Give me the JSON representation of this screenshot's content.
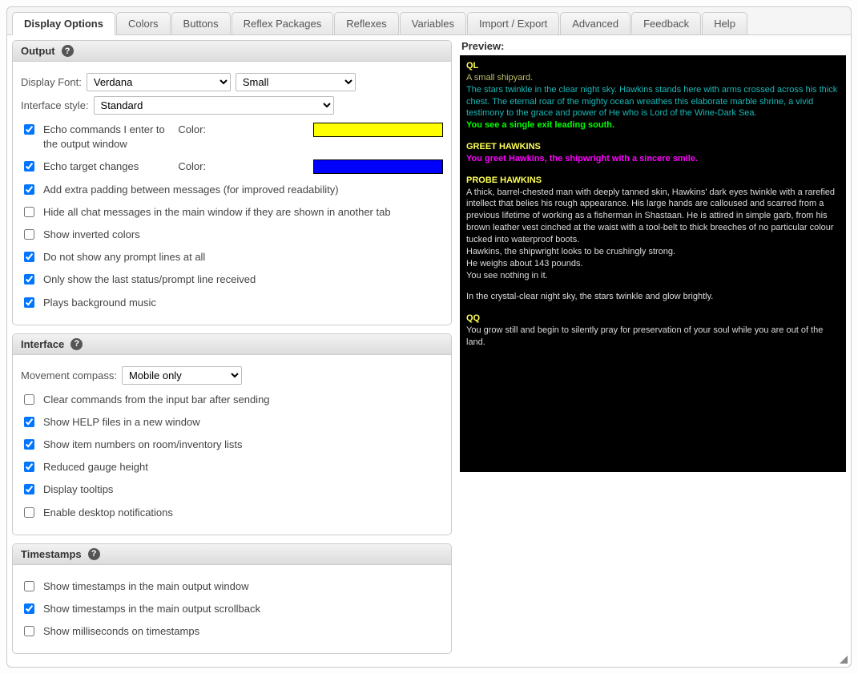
{
  "tabs": [
    {
      "label": "Display Options",
      "active": true
    },
    {
      "label": "Colors"
    },
    {
      "label": "Buttons"
    },
    {
      "label": "Reflex Packages"
    },
    {
      "label": "Reflexes"
    },
    {
      "label": "Variables"
    },
    {
      "label": "Import / Export"
    },
    {
      "label": "Advanced"
    },
    {
      "label": "Feedback"
    },
    {
      "label": "Help"
    }
  ],
  "output": {
    "title": "Output",
    "display_font_label": "Display Font:",
    "display_font_value": "Verdana",
    "display_size_value": "Small",
    "interface_style_label": "Interface style:",
    "interface_style_value": "Standard",
    "echo_commands": {
      "checked": true,
      "label": "Echo commands I enter to the output window",
      "color_label": "Color:",
      "color": "#ffff00"
    },
    "echo_target": {
      "checked": true,
      "label": "Echo target changes",
      "color_label": "Color:",
      "color": "#0000ff"
    },
    "extra_padding": {
      "checked": true,
      "label": "Add extra padding between messages (for improved readability)"
    },
    "hide_chat": {
      "checked": false,
      "label": "Hide all chat messages in the main window if they are shown in another tab"
    },
    "inverted": {
      "checked": false,
      "label": "Show inverted colors"
    },
    "no_prompt": {
      "checked": true,
      "label": "Do not show any prompt lines at all"
    },
    "last_status": {
      "checked": true,
      "label": "Only show the last status/prompt line received"
    },
    "music": {
      "checked": true,
      "label": "Plays background music"
    }
  },
  "interface": {
    "title": "Interface",
    "compass_label": "Movement compass:",
    "compass_value": "Mobile only",
    "clear_commands": {
      "checked": false,
      "label": "Clear commands from the input bar after sending"
    },
    "help_window": {
      "checked": true,
      "label": "Show HELP files in a new window"
    },
    "item_numbers": {
      "checked": true,
      "label": "Show item numbers on room/inventory lists"
    },
    "reduced_gauge": {
      "checked": true,
      "label": "Reduced gauge height"
    },
    "tooltips": {
      "checked": true,
      "label": "Display tooltips"
    },
    "desktop_notif": {
      "checked": false,
      "label": "Enable desktop notifications"
    }
  },
  "timestamps": {
    "title": "Timestamps",
    "main_output": {
      "checked": false,
      "label": "Show timestamps in the main output window"
    },
    "scrollback": {
      "checked": true,
      "label": "Show timestamps in the main output scrollback"
    },
    "millis": {
      "checked": false,
      "label": "Show milliseconds on timestamps"
    }
  },
  "preview": {
    "label": "Preview:",
    "ql_cmd": "QL",
    "ql_title": "A small shipyard.",
    "ql_desc": "The stars twinkle in the clear night sky. Hawkins stands here with arms crossed across his thick chest. The eternal roar of the mighty ocean wreathes this elaborate marble shrine, a vivid testimony to the grace and power of He who is Lord of the Wine-Dark Sea.",
    "ql_exit": "You see a single exit leading south.",
    "greet_cmd": "GREET HAWKINS",
    "greet_resp": "You greet Hawkins, the shipwright with a sincere smile.",
    "probe_cmd": "PROBE HAWKINS",
    "probe_desc": "A thick, barrel-chested man with deeply tanned skin, Hawkins' dark eyes twinkle with a rarefied intellect that belies his rough appearance. His large hands are calloused and scarred from a previous lifetime of working as a fisherman in Shastaan. He is attired in simple garb, from his brown leather vest cinched at the waist with a tool-belt to thick breeches of no particular colour tucked into waterproof boots.",
    "probe_strength": "Hawkins, the shipwright looks to be crushingly strong.",
    "probe_weight": "He weighs about 143 pounds.",
    "probe_nothing": "You see nothing in it.",
    "sky": "In the crystal-clear night sky, the stars twinkle and glow brightly.",
    "qq_cmd": "QQ",
    "qq_resp": "You grow still and begin to silently pray for preservation of your soul while you are out of the land."
  }
}
